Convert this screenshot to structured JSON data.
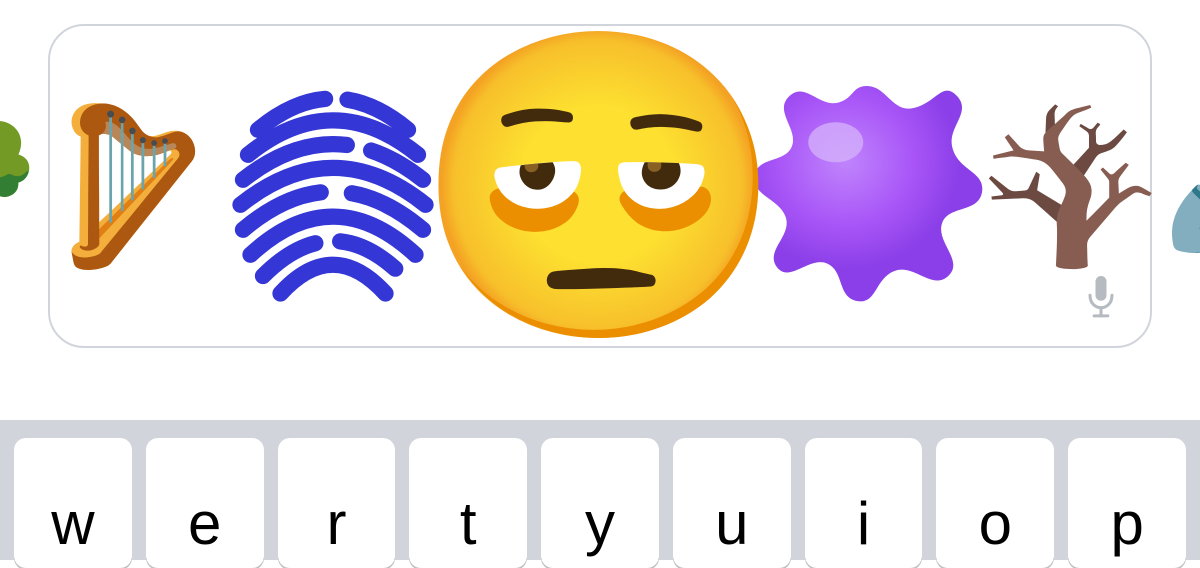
{
  "text_field": {
    "emojis": [
      {
        "name": "radish",
        "glyph": "🫜",
        "size": "small"
      },
      {
        "name": "harp",
        "glyph": "🪉",
        "size": "medium"
      },
      {
        "name": "fingerprint",
        "glyph": "🫆",
        "size": "large"
      },
      {
        "name": "bags-under-eyes-face",
        "glyph": "🫩",
        "size": "xl"
      },
      {
        "name": "splatter",
        "glyph": "🫟",
        "size": "large"
      },
      {
        "name": "leafless-tree",
        "glyph": "🪾",
        "size": "medium"
      },
      {
        "name": "shovel",
        "glyph": "🪏",
        "size": "small"
      }
    ],
    "mic_icon": "microphone-icon"
  },
  "keyboard": {
    "row1": [
      {
        "label": "w"
      },
      {
        "label": "e"
      },
      {
        "label": "r"
      },
      {
        "label": "t"
      },
      {
        "label": "y"
      },
      {
        "label": "u"
      },
      {
        "label": "i"
      },
      {
        "label": "o"
      },
      {
        "label": "p"
      }
    ]
  }
}
